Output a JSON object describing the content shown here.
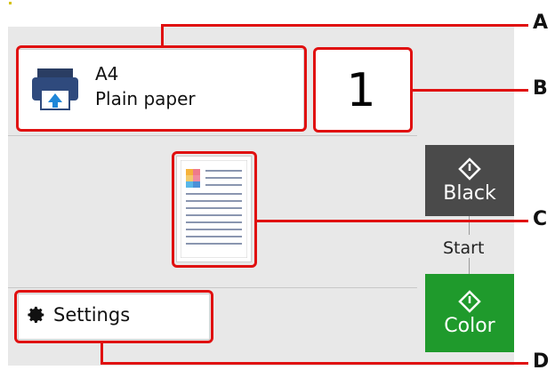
{
  "paper": {
    "size": "A4",
    "type": "Plain paper"
  },
  "copies": {
    "value": "1"
  },
  "start": {
    "label": "Start",
    "black_label": "Black",
    "color_label": "Color"
  },
  "settings": {
    "label": "Settings"
  },
  "callouts": {
    "a": "A",
    "b": "B",
    "c": "C",
    "d": "D"
  },
  "colors": {
    "callout": "#e01010",
    "black_button": "#4a4a4a",
    "color_button": "#1f9a2c",
    "panel": "#e8e8e8"
  },
  "icons": {
    "paper": "printer-icon",
    "settings": "gear-icon",
    "start": "diamond-start-icon"
  }
}
